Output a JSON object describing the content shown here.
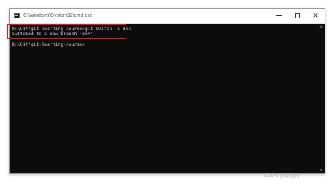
{
  "window": {
    "title": "C:\\Windows\\System32\\cmd.exe",
    "minimize_glyph": "",
    "close_glyph": "✕"
  },
  "console": {
    "lines": [
      "D:\\Git\\git-learning-course>git switch -c dev",
      "Switched to a new branch 'dev'",
      "D:\\Git\\git-learning-course>"
    ]
  },
  "watermark": "CSDN @韩曙亮",
  "colors": {
    "console_background": "#0c0c0c",
    "console_text": "#cccccc",
    "highlight_border": "#e0191f",
    "titlebar": "#ffffff"
  },
  "icons": {
    "app": "cmd-icon",
    "minimize": "minimize-icon",
    "maximize": "maximize-icon",
    "close": "close-icon"
  }
}
